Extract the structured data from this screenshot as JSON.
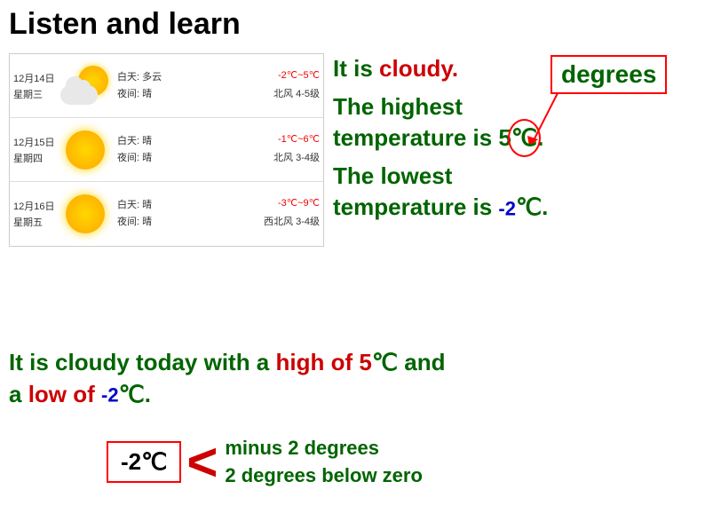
{
  "title": "Listen and learn",
  "weather": {
    "rows": [
      {
        "date": "12月14日",
        "day": "星期三",
        "icon": "sun-cloud",
        "daytime": "白天: 多云",
        "night": "夜间: 晴",
        "wind": "北风 4-5级",
        "temp": "-2℃~5℃"
      },
      {
        "date": "12月15日",
        "day": "星期四",
        "icon": "sun",
        "daytime": "白天: 晴",
        "night": "夜间: 晴",
        "wind": "北风 3-4级",
        "temp": "-1℃~6℃"
      },
      {
        "date": "12月16日",
        "day": "星期五",
        "icon": "sun",
        "daytime": "白天: 晴",
        "night": "夜间: 晴",
        "wind": "西北风 3-4级",
        "temp": "-3℃~9℃"
      }
    ]
  },
  "sentences": {
    "s1_prefix": "It is ",
    "s1_highlight": "cloudy.",
    "degrees_box": "degrees",
    "s2_line1": "The highest",
    "s2_line2_prefix": "temperature is 5",
    "s2_degree": "℃",
    "s2_period": ".",
    "s3_line1": "The lowest",
    "s3_line2_prefix": "temperature is ",
    "s3_neg": "-2",
    "s3_degree_period": "℃."
  },
  "bottom": {
    "text1": "It is cloudy today with a ",
    "highlight1": "high of 5",
    "degree1": "℃",
    "text2": " and",
    "text3": "a ",
    "highlight2": "low of ",
    "neg2": "-2",
    "degree2": "℃",
    "period": "."
  },
  "minus_box": {
    "label": "-2℃",
    "explanation1": "minus 2 degrees",
    "explanation2": "2 degrees below zero"
  }
}
